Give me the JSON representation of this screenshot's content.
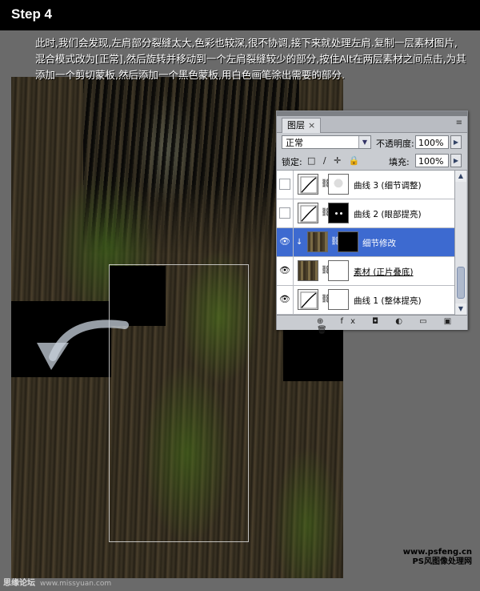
{
  "header": {
    "step": "Step 4"
  },
  "intro": {
    "text": "此时,我们会发现,左肩部分裂缝太大,色彩也较深,很不协调,接下来就处理左肩.复制一层素材图片,混合模式改为[正常],然后旋转并移动到一个左肩裂缝较少的部分,按住Alt在两层素材之间点击,为其添加一个剪切蒙板,然后添加一个黑色蒙板,用白色画笔涂出需要的部分."
  },
  "layers_panel": {
    "tab_label": "图层",
    "tab_close": "×",
    "menu_icon": "≡",
    "blend_mode": "正常",
    "opacity_label": "不透明度:",
    "opacity_value": "100%",
    "lock_label": "锁定:",
    "lock_icons": "□ ∕ ✛ 🔒",
    "fill_label": "填充:",
    "fill_value": "100%",
    "layers": [
      {
        "name": "曲线 3 (细节调整)",
        "visible": false,
        "kind": "adjustment",
        "mask": "face"
      },
      {
        "name": "曲线 2 (眼部提亮)",
        "visible": false,
        "kind": "adjustment",
        "mask": "eyes"
      },
      {
        "name": "细节修改",
        "visible": true,
        "kind": "photo",
        "mask": "black",
        "selected": true,
        "clipped": true
      },
      {
        "name": "素材 (正片叠底)",
        "visible": true,
        "kind": "photo",
        "mask": "white"
      },
      {
        "name": "曲线 1 (整体提亮)",
        "visible": true,
        "kind": "adjustment",
        "mask": "white"
      }
    ],
    "footer_icons": "⊕ fx ◘ ◐ ▭ ▣ 🗑"
  },
  "watermarks": {
    "right_line1": "www.psfeng.cn",
    "right_line2": "PS风图像处理网",
    "left_main": "思缘论坛",
    "left_url": "www.missyuan.com"
  }
}
